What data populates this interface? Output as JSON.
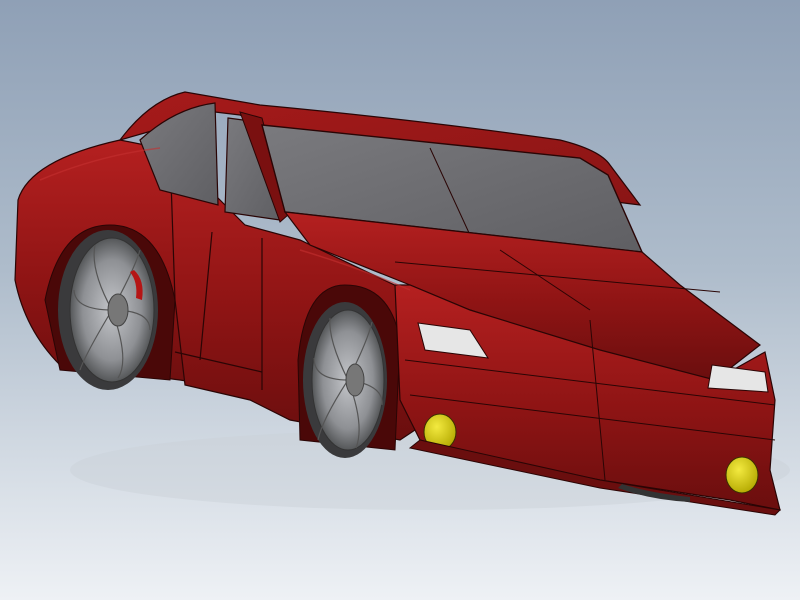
{
  "viewport": {
    "background_top": "#8fa0b6",
    "background_bottom": "#eef1f5"
  },
  "model": {
    "body_color": "#8e1414",
    "body_highlight": "#b52020",
    "body_shadow": "#5a0a0a",
    "glass_color": "#6f6f73",
    "wheel_color": "#9a9ca0",
    "fog_light_color": "#d4c800",
    "headlight_color": "#e6e6e6",
    "brake_caliper_color": "#b51515"
  }
}
